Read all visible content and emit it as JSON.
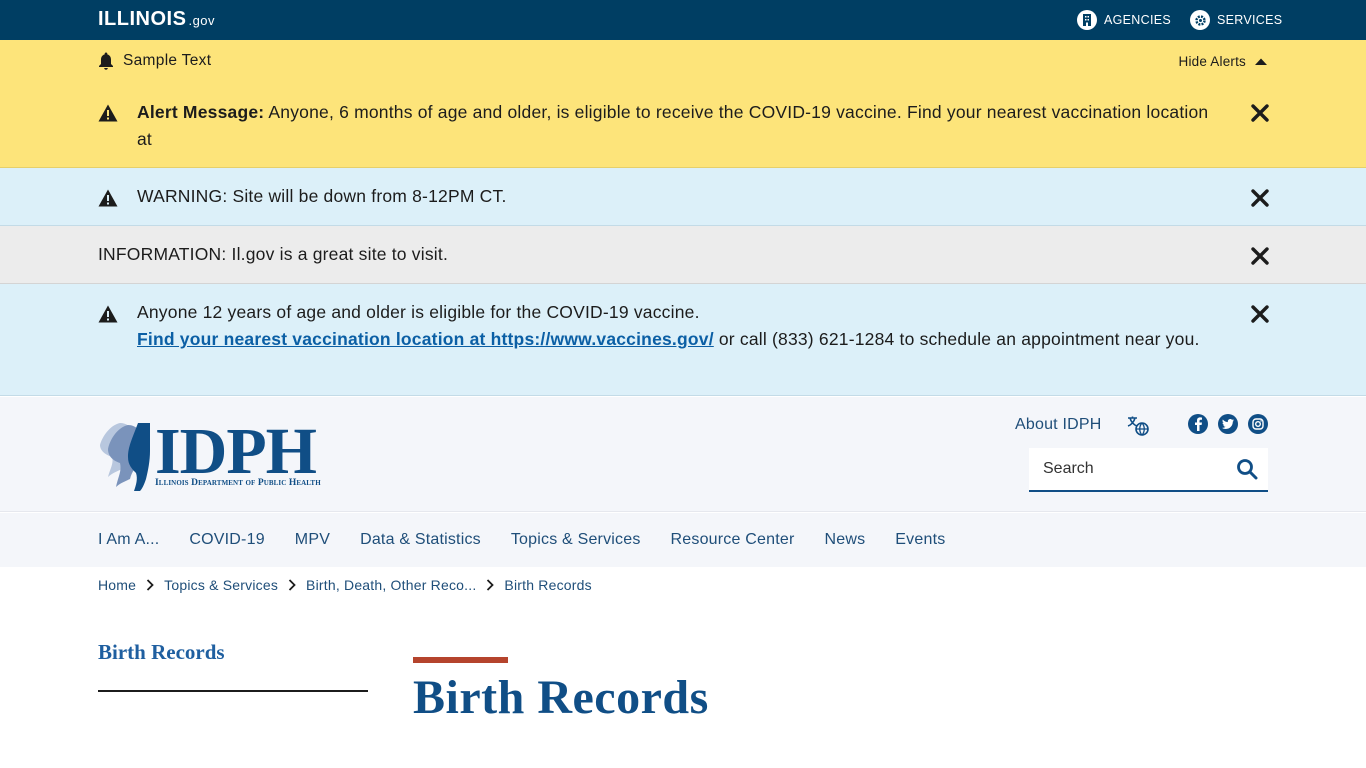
{
  "govbar": {
    "logo_main": "ILLINOIS",
    "logo_suffix": ".gov",
    "agencies_label": "AGENCIES",
    "services_label": "SERVICES"
  },
  "alerts": {
    "sample_text": "Sample Text",
    "hide_label": "Hide Alerts",
    "alert_message_label": "Alert Message:",
    "alert_message_text": " Anyone, 6 months of age and older, is eligible to receive the COVID-19 vaccine. Find your nearest vaccination location at",
    "warning_text": "WARNING: Site will be down from 8-12PM CT.",
    "info_text": "INFORMATION: Il.gov is a great site to visit.",
    "covid_line1": "Anyone 12 years of age and older is eligible for the COVID-19 vaccine.",
    "covid_link": "Find your nearest vaccination location at https://www.vaccines.gov/",
    "covid_line2": " or call (833) 621-1284 to schedule an appointment near you."
  },
  "header": {
    "logo_word": "IDPH",
    "logo_sub": "Illinois Department of Public Health",
    "about_label": "About IDPH",
    "search_placeholder": "Search"
  },
  "nav": {
    "items": [
      "I Am A...",
      "COVID-19",
      "MPV",
      "Data & Statistics",
      "Topics & Services",
      "Resource Center",
      "News",
      "Events"
    ]
  },
  "breadcrumb": {
    "items": [
      "Home",
      "Topics & Services",
      "Birth, Death, Other Reco...",
      "Birth Records"
    ]
  },
  "content": {
    "sidebar_title": "Birth Records",
    "page_title": "Birth Records"
  },
  "colors": {
    "govbar_bg": "#003e63",
    "alert_yellow": "#fde47a",
    "alert_blue": "#dcf0f9",
    "alert_gray": "#ececec",
    "brand_blue": "#104e86",
    "accent_red": "#b5442d"
  }
}
